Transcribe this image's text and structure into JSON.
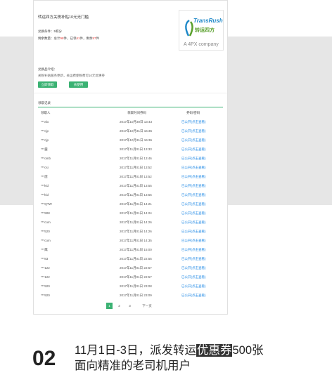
{
  "card": {
    "title": "转运四方关税补贴10元无门槛",
    "condition": "兑换条件：5积分",
    "qty_label": "剩余数量：总计",
    "qty_total": "98",
    "qty_mid": "件，已领",
    "qty_taken": "41",
    "qty_mid2": "件，剩余",
    "qty_left": "57",
    "qty_end": "件",
    "intro_heading": "兑换品介绍：",
    "intro_text": "关税补贴服务更新，关运费使税费可10元优惠券",
    "get_button": "立即领取",
    "use_button": "去使用"
  },
  "logo": {
    "en": "TransRush",
    "cn": "转运四方",
    "sub": "A 4PX company"
  },
  "records": {
    "heading": "领取记录",
    "columns": [
      "领取人",
      "领取时间券码",
      "券码/密码"
    ],
    "rows": [
      {
        "user": "***alo",
        "time": "2017年10月30日 13:43",
        "status": "已公开(点击查看)"
      },
      {
        "user": "***cjp",
        "time": "2017年10月31日 16:36",
        "status": "已公开(点击查看)"
      },
      {
        "user": "***cjp",
        "time": "2017年10月31日 16:36",
        "status": "已公开(点击查看)"
      },
      {
        "user": "***露",
        "time": "2017年11月01日 13:33",
        "status": "已公开(点击查看)"
      },
      {
        "user": "***omb",
        "time": "2017年11月01日 13:46",
        "status": "已公开(点击查看)"
      },
      {
        "user": "***csi",
        "time": "2017年11月01日 13:52",
        "status": "已公开(点击查看)"
      },
      {
        "user": "***唐",
        "time": "2017年11月01日 13:52",
        "status": "已公开(点击查看)"
      },
      {
        "user": "***kid",
        "time": "2017年11月01日 13:55",
        "status": "已公开(点击查看)"
      },
      {
        "user": "***kid",
        "time": "2017年11月01日 13:55",
        "status": "已公开(点击查看)"
      },
      {
        "user": "***QTW",
        "time": "2017年11月01日 14:21",
        "status": "已公开(点击查看)"
      },
      {
        "user": "***908",
        "time": "2017年11月01日 14:24",
        "status": "已公开(点击查看)"
      },
      {
        "user": "***com",
        "time": "2017年11月01日 14:26",
        "status": "已公开(点击查看)"
      },
      {
        "user": "***520",
        "time": "2017年11月01日 14:26",
        "status": "已公开(点击查看)"
      },
      {
        "user": "***com",
        "time": "2017年11月01日 14:35",
        "status": "已公开(点击查看)"
      },
      {
        "user": "***鹰",
        "time": "2017年11月01日 15:00",
        "status": "已公开(点击查看)"
      },
      {
        "user": "***83",
        "time": "2017年11月01日 22:55",
        "status": "已公开(点击查看)"
      },
      {
        "user": "***122",
        "time": "2017年11月01日 22:57",
        "status": "已公开(点击查看)"
      },
      {
        "user": "***122",
        "time": "2017年11月01日 22:57",
        "status": "已公开(点击查看)"
      },
      {
        "user": "***920",
        "time": "2017年11月01日 23:08",
        "status": "已公开(点击查看)"
      },
      {
        "user": "***920",
        "time": "2017年11月01日 23:09",
        "status": "已公开(点击查看)"
      }
    ]
  },
  "pagination": {
    "pages": [
      "1",
      "2",
      "3"
    ],
    "next": "下一页"
  },
  "step": {
    "number": "02",
    "line1_before": "11月1日-3日，派发转运",
    "line1_highlight": "优惠券",
    "line1_after": "500张",
    "line2": "面向精准的老司机用户"
  },
  "colors": {
    "accent_green": "#3bb273",
    "link_blue": "#1e88e5",
    "highlight_red": "#e53935"
  }
}
